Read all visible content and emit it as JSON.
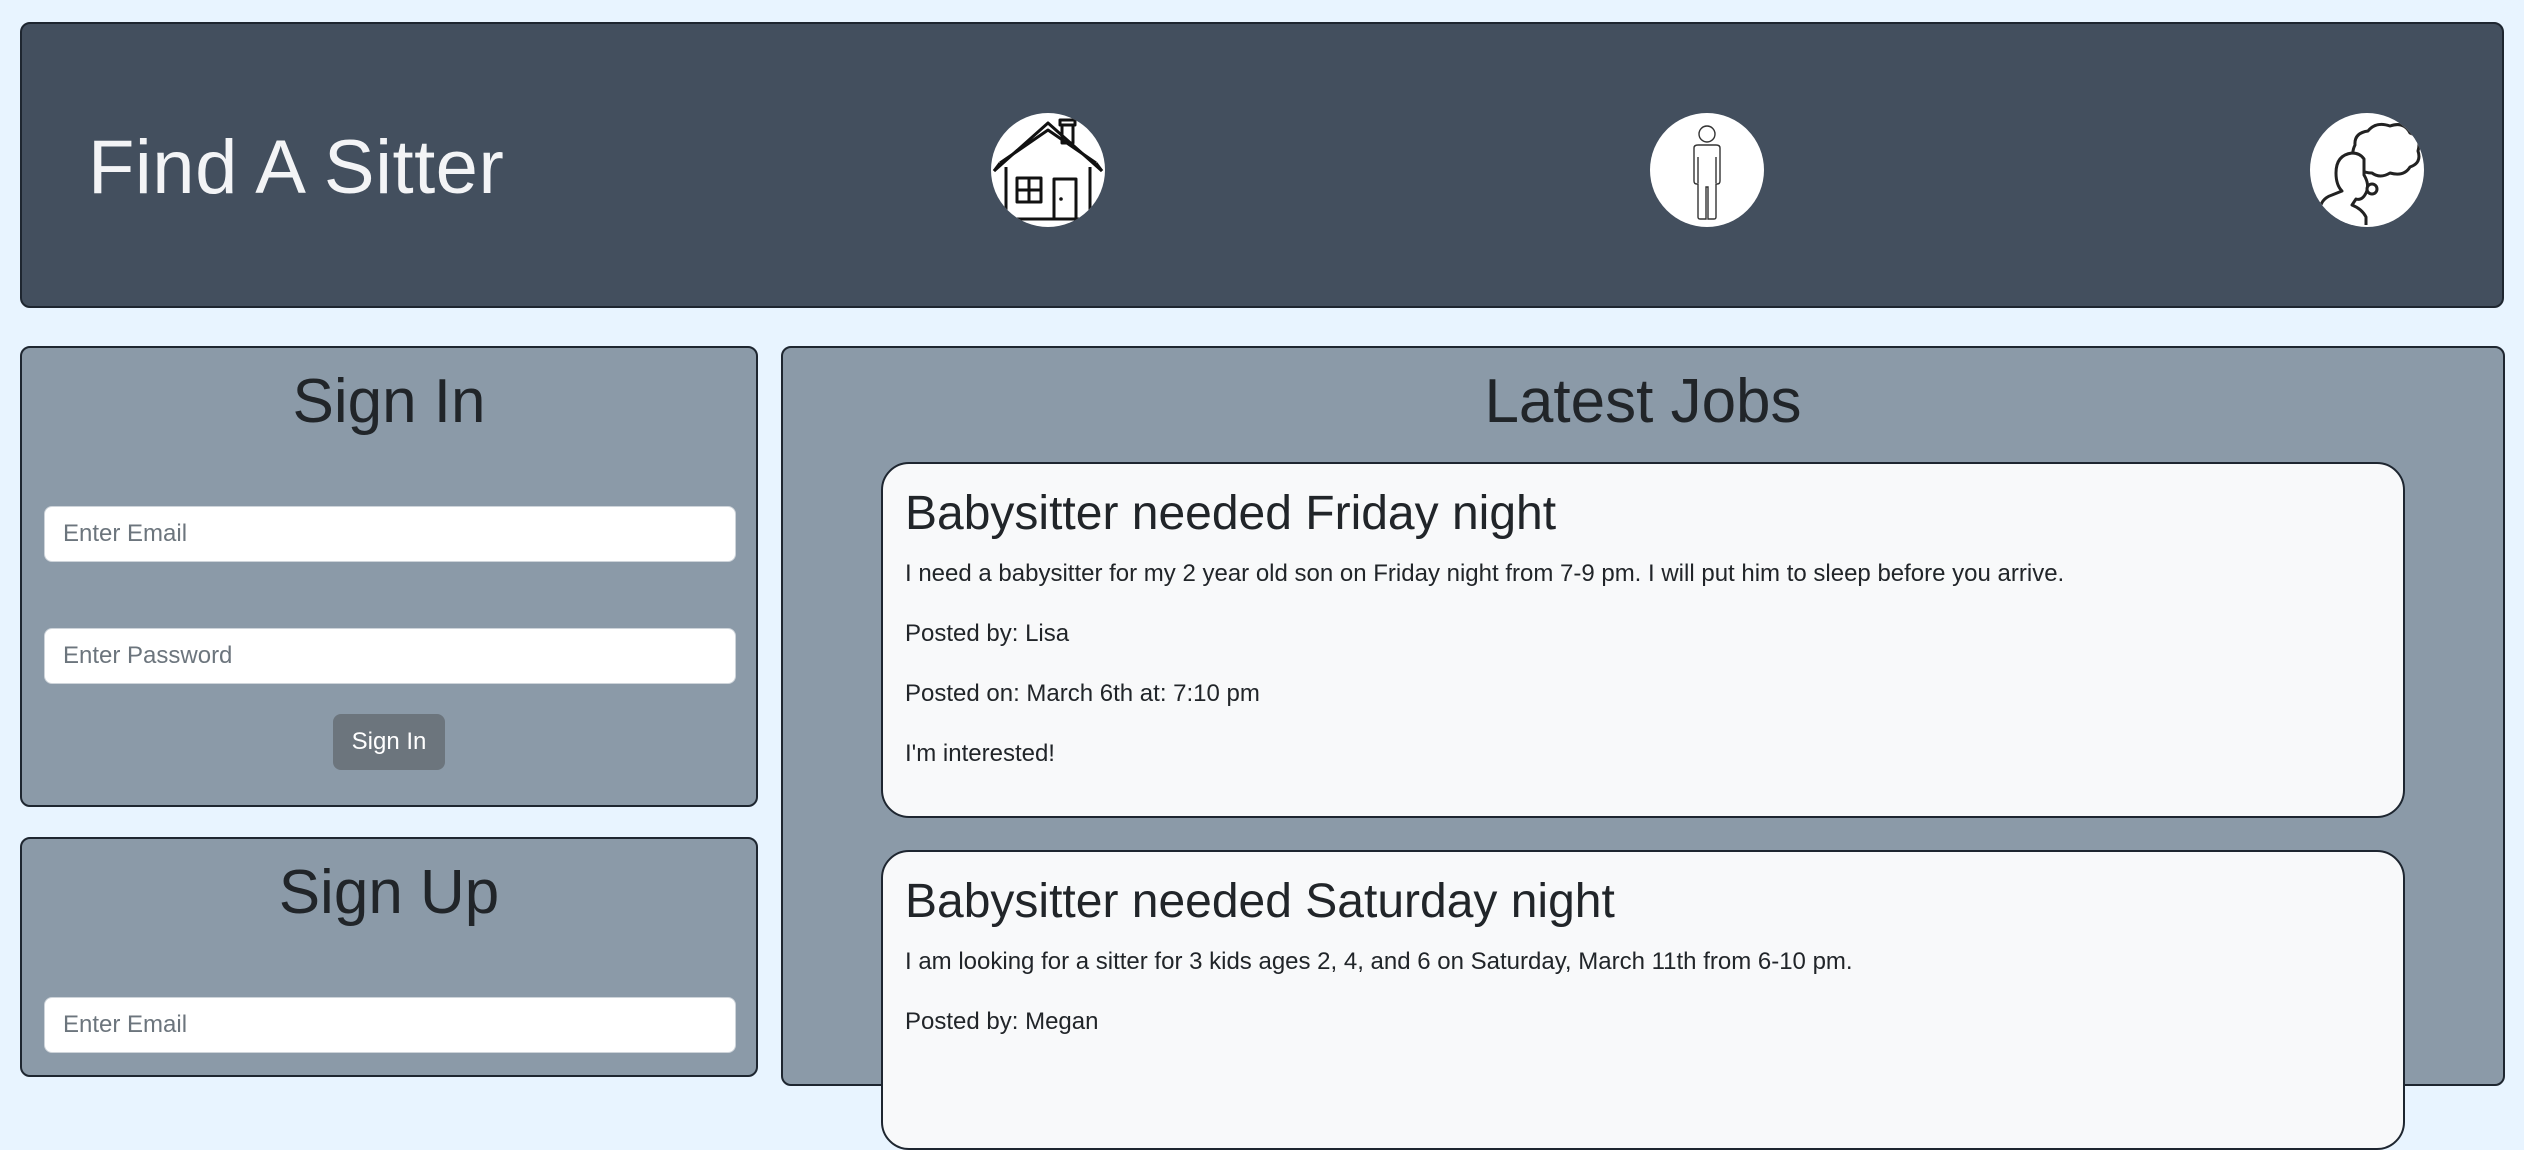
{
  "header": {
    "title": "Find A Sitter",
    "icons": [
      "home-icon",
      "person-icon",
      "thinking-person-icon"
    ]
  },
  "signin": {
    "title": "Sign In",
    "email_placeholder": "Enter Email",
    "password_placeholder": "Enter Password",
    "button_label": "Sign In"
  },
  "signup": {
    "title": "Sign Up",
    "email_placeholder": "Enter Email"
  },
  "jobs": {
    "title": "Latest Jobs",
    "items": [
      {
        "title": "Babysitter needed Friday night",
        "description": "I need a babysitter for my 2 year old son on Friday night from 7-9 pm. I will put him to sleep before you arrive.",
        "posted_by": "Posted by: Lisa",
        "posted_on": "Posted on: March 6th at: 7:10 pm",
        "interest_label": "I'm interested!"
      },
      {
        "title": "Babysitter needed Saturday night",
        "description": "I am looking for a sitter for 3 kids ages 2, 4, and 6 on Saturday, March 11th from 6-10 pm.",
        "posted_by": "Posted by: Megan"
      }
    ]
  },
  "colors": {
    "page_background": "#e8f4ff",
    "header_background": "#434f5e",
    "panel_background": "#8b9aa8",
    "card_background": "#f8f9fa",
    "button_background": "#6c757d"
  }
}
